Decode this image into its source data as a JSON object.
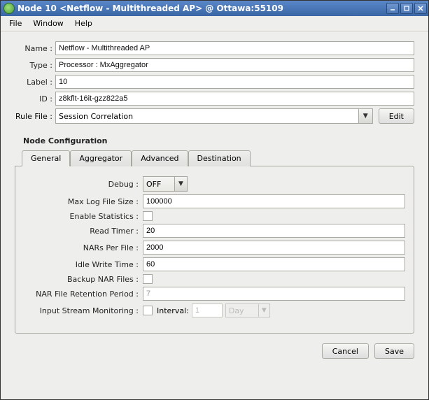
{
  "window": {
    "title": "Node 10 <Netflow - Multithreaded AP> @ Ottawa:55109"
  },
  "menu": {
    "file": "File",
    "window": "Window",
    "help": "Help"
  },
  "form": {
    "name_label": "Name :",
    "name_value": "Netflow - Multithreaded AP",
    "type_label": "Type :",
    "type_value": "Processor : MxAggregator",
    "label_label": "Label :",
    "label_value": "10",
    "id_label": "ID :",
    "id_value": "z8kflt-16it-gzz822a5",
    "rulefile_label": "Rule File :",
    "rulefile_value": "Session Correlation",
    "edit_label": "Edit"
  },
  "config": {
    "legend": "Node Configuration",
    "tabs": {
      "general": "General",
      "aggregator": "Aggregator",
      "advanced": "Advanced",
      "destination": "Destination"
    },
    "general": {
      "debug_label": "Debug :",
      "debug_value": "OFF",
      "maxlog_label": "Max Log File Size :",
      "maxlog_value": "100000",
      "stats_label": "Enable Statistics :",
      "readtimer_label": "Read Timer :",
      "readtimer_value": "20",
      "nars_label": "NARs Per File :",
      "nars_value": "2000",
      "idle_label": "Idle Write Time :",
      "idle_value": "60",
      "backup_label": "Backup NAR Files :",
      "retention_label": "NAR File Retention Period :",
      "retention_value": "7",
      "ism_label": "Input Stream Monitoring :",
      "ism_interval_label": "Interval:",
      "ism_interval_value": "1",
      "ism_unit": "Day"
    }
  },
  "footer": {
    "cancel": "Cancel",
    "save": "Save"
  }
}
